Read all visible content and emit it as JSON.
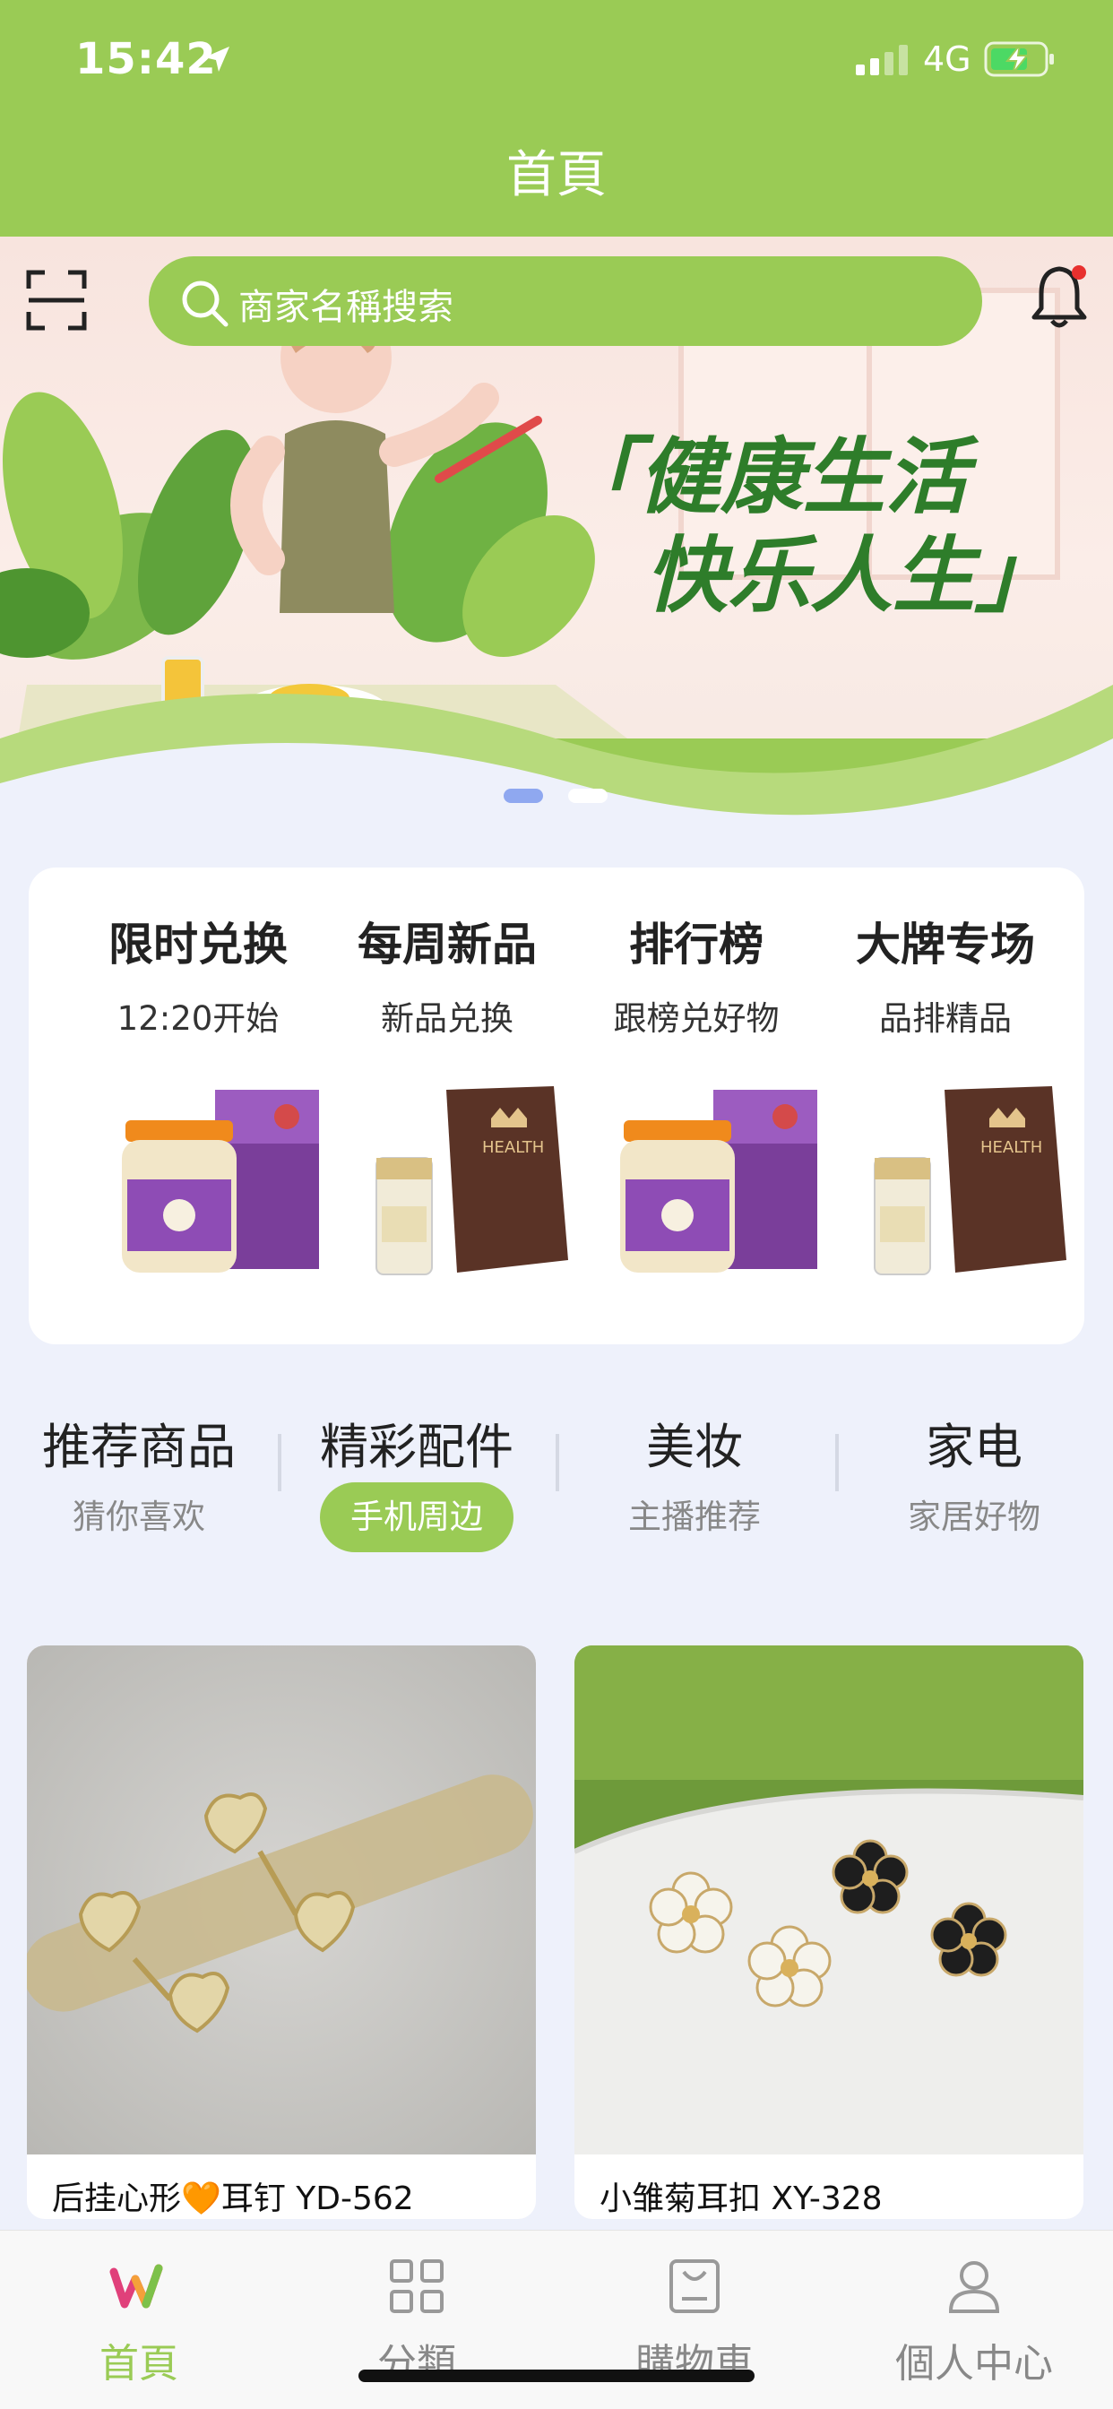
{
  "status_bar": {
    "time": "15:42",
    "network": "4G"
  },
  "nav": {
    "title": "首頁"
  },
  "search": {
    "placeholder": "商家名稱搜索"
  },
  "banner": {
    "line1": "「健康生活",
    "line2": "快乐人生」"
  },
  "promo": [
    {
      "title": "限时兑换",
      "subtitle": "12:20开始",
      "image": "bird-nest-jar"
    },
    {
      "title": "每周新品",
      "subtitle": "新品兑换",
      "image": "health-gift-box"
    },
    {
      "title": "排行榜",
      "subtitle": "跟榜兑好物",
      "image": "bird-nest-jar"
    },
    {
      "title": "大牌专场",
      "subtitle": "品排精品",
      "image": "health-gift-box"
    }
  ],
  "categories": [
    {
      "title": "推荐商品",
      "subtitle": "猜你喜欢",
      "active": false
    },
    {
      "title": "精彩配件",
      "subtitle": "手机周边",
      "active": true
    },
    {
      "title": "美妆",
      "subtitle": "主播推荐",
      "active": false
    },
    {
      "title": "家电",
      "subtitle": "家居好物",
      "active": false
    }
  ],
  "products": [
    {
      "name": "后挂心形🧡耳钉 YD-562"
    },
    {
      "name": "小雏菊耳扣 XY-328"
    }
  ],
  "tabbar": [
    {
      "label": "首頁",
      "icon": "home-logo-icon",
      "active": true
    },
    {
      "label": "分類",
      "icon": "grid-icon",
      "active": false
    },
    {
      "label": "購物車",
      "icon": "cart-icon",
      "active": false
    },
    {
      "label": "個人中心",
      "icon": "person-icon",
      "active": false
    }
  ],
  "colors": {
    "accent": "#9ACB55",
    "background": "#EEF1FB",
    "dot_active": "#8FA8F0"
  }
}
